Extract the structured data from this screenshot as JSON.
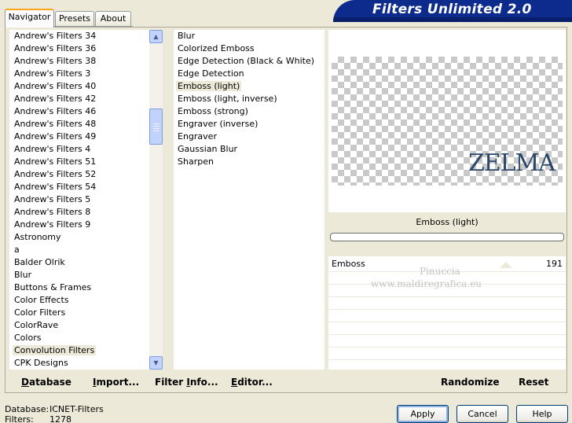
{
  "tabs": [
    {
      "label": "Navigator",
      "active": true
    },
    {
      "label": "Presets",
      "active": false
    },
    {
      "label": "About",
      "active": false
    }
  ],
  "banner": {
    "title": "Filters Unlimited 2.0"
  },
  "categories": {
    "items": [
      "Andrew's Filters 34",
      "Andrew's Filters 36",
      "Andrew's Filters 38",
      "Andrew's Filters 3",
      "Andrew's Filters 40",
      "Andrew's Filters 42",
      "Andrew's Filters 46",
      "Andrew's Filters 48",
      "Andrew's Filters 49",
      "Andrew's Filters 4",
      "Andrew's Filters 51",
      "Andrew's Filters 52",
      "Andrew's Filters 54",
      "Andrew's Filters 5",
      "Andrew's Filters 8",
      "Andrew's Filters 9",
      "Astronomy",
      "a",
      "Balder Olrik",
      "Blur",
      "Buttons & Frames",
      "Color Effects",
      "Color Filters",
      "ColorRave",
      "Colors",
      "Convolution Filters",
      "CPK Designs"
    ],
    "selected": "Convolution Filters"
  },
  "filters": {
    "items": [
      "Blur",
      "Colorized Emboss",
      "Edge Detection (Black & White)",
      "Edge Detection",
      "Emboss (light)",
      "Emboss (light, inverse)",
      "Emboss (strong)",
      "Engraver (inverse)",
      "Engraver",
      "Gaussian Blur",
      "Sharpen"
    ],
    "selected": "Emboss (light)"
  },
  "preview": {
    "logo_text": "ZELMA"
  },
  "filter_title": "Emboss (light)",
  "progress": 0,
  "parameters": [
    {
      "label": "Emboss",
      "value": "191"
    }
  ],
  "watermark": {
    "line1": "Pinuccia",
    "line2": "www.maldiregrafica.eu"
  },
  "toolbar": {
    "database": {
      "u": "D",
      "rest": "atabase"
    },
    "import": {
      "u": "I",
      "rest": "mport..."
    },
    "filter_info": {
      "pre": "Filter ",
      "u": "I",
      "rest": "nfo..."
    },
    "editor": {
      "u": "E",
      "rest": "ditor..."
    },
    "randomize": "Randomize",
    "reset": "Reset"
  },
  "status": {
    "database_label": "Database:",
    "database_value": "ICNET-Filters",
    "filters_label": "Filters:",
    "filters_value": "1278"
  },
  "buttons": {
    "apply": "Apply",
    "cancel": "Cancel",
    "help": "Help"
  },
  "colors": {
    "banner": "#0c2b8c",
    "selection": "#ece9d8",
    "window": "#ece9d8"
  }
}
